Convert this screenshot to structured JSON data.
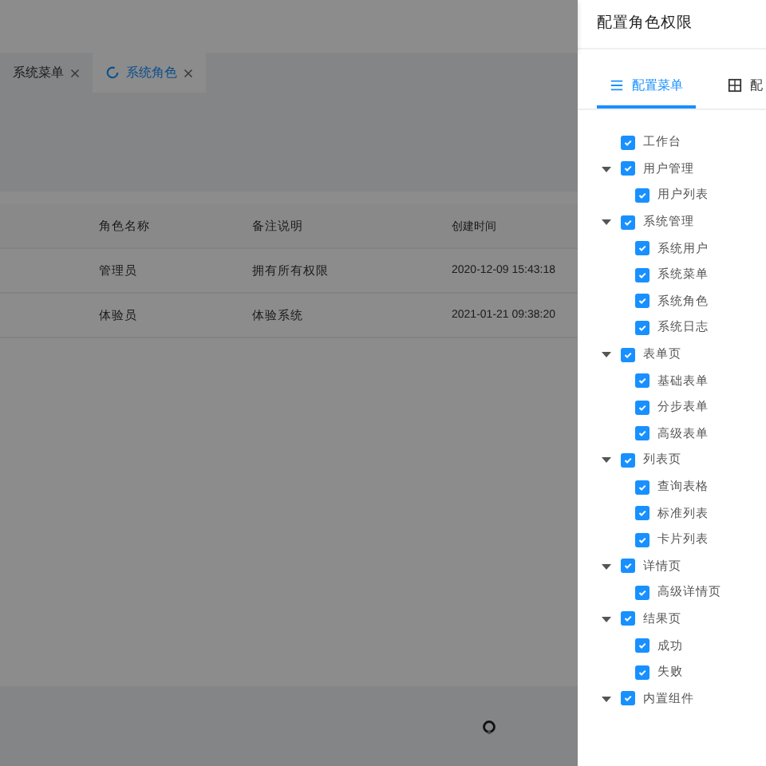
{
  "tabs": [
    {
      "label": "系统菜单",
      "selected": false
    },
    {
      "label": "系统角色",
      "selected": true
    }
  ],
  "table": {
    "columns": [
      "角色名称",
      "备注说明",
      "创建时间"
    ],
    "rows": [
      [
        "管理员",
        "拥有所有权限",
        "2020-12-09 15:43:18"
      ],
      [
        "体验员",
        "体验系统",
        "2021-01-21 09:38:20"
      ]
    ]
  },
  "drawer": {
    "title": "配置角色权限",
    "tabs": [
      {
        "label": "配置菜单",
        "selected": true
      },
      {
        "label": "配",
        "selected": false
      }
    ],
    "tree": [
      {
        "label": "工作台",
        "checked": true
      },
      {
        "label": "用户管理",
        "checked": true,
        "expanded": true,
        "children": [
          {
            "label": "用户列表",
            "checked": true
          }
        ]
      },
      {
        "label": "系统管理",
        "checked": true,
        "expanded": true,
        "children": [
          {
            "label": "系统用户",
            "checked": true
          },
          {
            "label": "系统菜单",
            "checked": true
          },
          {
            "label": "系统角色",
            "checked": true
          },
          {
            "label": "系统日志",
            "checked": true
          }
        ]
      },
      {
        "label": "表单页",
        "checked": true,
        "expanded": true,
        "children": [
          {
            "label": "基础表单",
            "checked": true
          },
          {
            "label": "分步表单",
            "checked": true
          },
          {
            "label": "高级表单",
            "checked": true
          }
        ]
      },
      {
        "label": "列表页",
        "checked": true,
        "expanded": true,
        "children": [
          {
            "label": "查询表格",
            "checked": true
          },
          {
            "label": "标准列表",
            "checked": true
          },
          {
            "label": "卡片列表",
            "checked": true
          }
        ]
      },
      {
        "label": "详情页",
        "checked": true,
        "expanded": true,
        "children": [
          {
            "label": "高级详情页",
            "checked": true
          }
        ]
      },
      {
        "label": "结果页",
        "checked": true,
        "expanded": true,
        "children": [
          {
            "label": "成功",
            "checked": true
          },
          {
            "label": "失败",
            "checked": true
          }
        ]
      },
      {
        "label": "内置组件",
        "checked": true,
        "expanded": true
      }
    ]
  }
}
